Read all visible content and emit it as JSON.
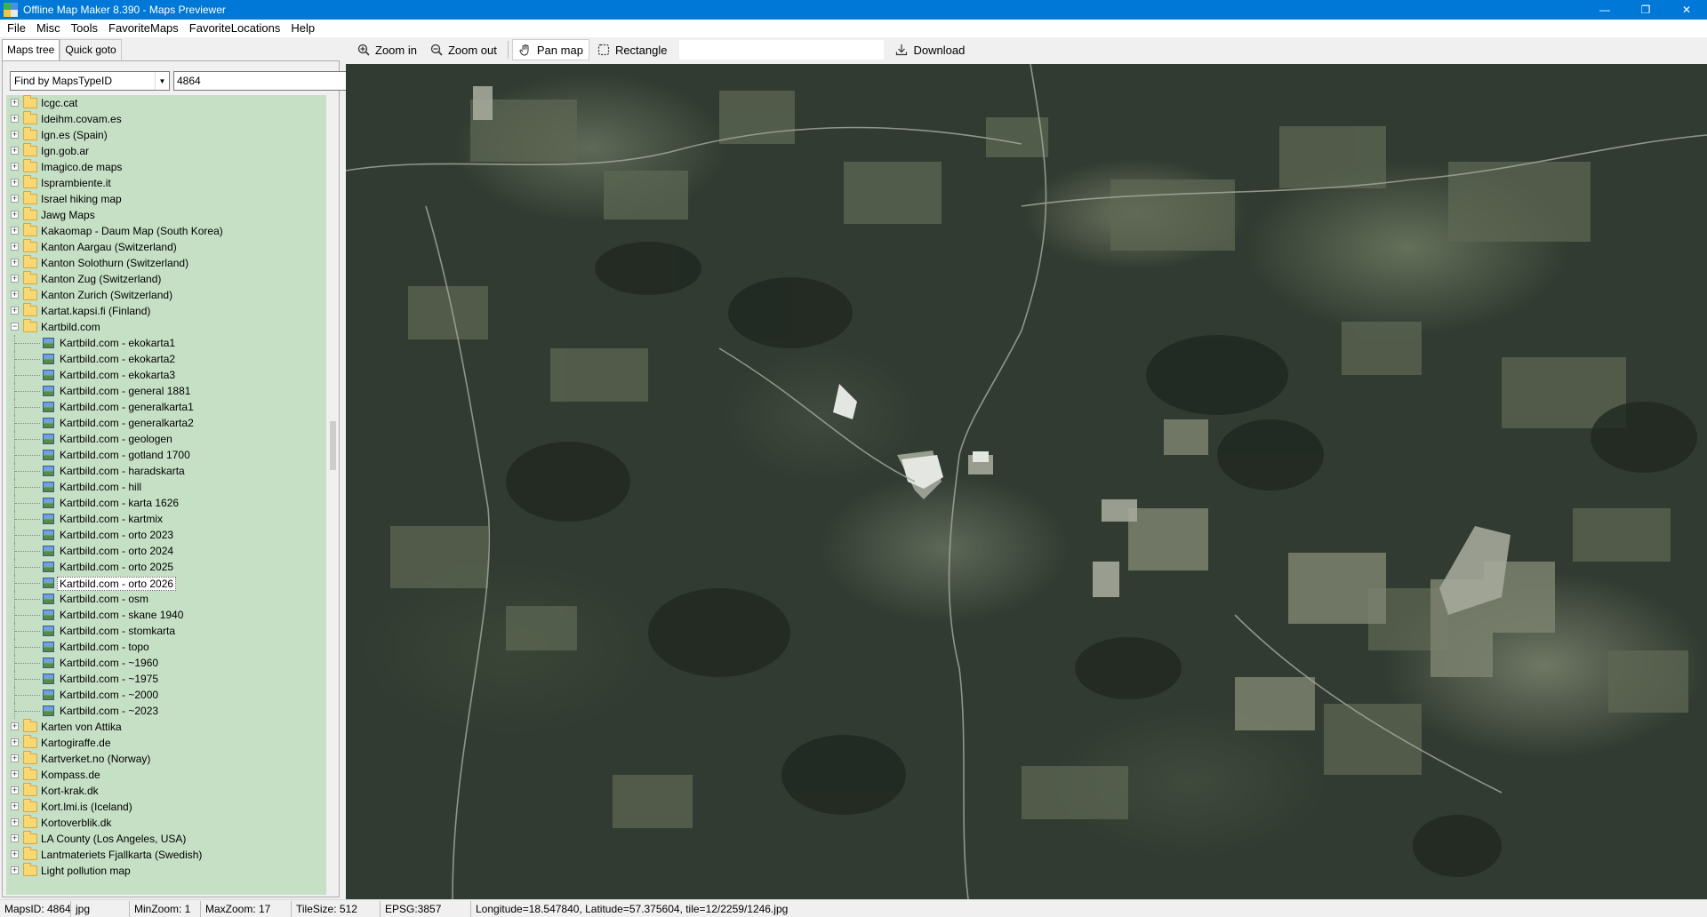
{
  "window": {
    "title": "Offline Map Maker 8.390 - Maps Previewer",
    "minimize": "—",
    "maximize": "❐",
    "close": "✕"
  },
  "menu": [
    "File",
    "Misc",
    "Tools",
    "FavoriteMaps",
    "FavoriteLocations",
    "Help"
  ],
  "left": {
    "tabs": [
      "Maps tree",
      "Quick goto"
    ],
    "find_mode": "Find by MapsTypeID",
    "find_value": "4864",
    "tree_top": [
      "Icgc.cat",
      "Ideihm.covam.es",
      "Ign.es (Spain)",
      "Ign.gob.ar",
      "Imagico.de maps",
      "Isprambiente.it",
      "Israel hiking map",
      "Jawg Maps",
      "Kakaomap - Daum Map (South Korea)",
      "Kanton Aargau (Switzerland)",
      "Kanton Solothurn (Switzerland)",
      "Kanton Zug (Switzerland)",
      "Kanton Zurich (Switzerland)",
      "Kartat.kapsi.fi (Finland)"
    ],
    "expanded_folder": "Kartbild.com",
    "tree_children": [
      "Kartbild.com - ekokarta1",
      "Kartbild.com - ekokarta2",
      "Kartbild.com - ekokarta3",
      "Kartbild.com - general 1881",
      "Kartbild.com - generalkarta1",
      "Kartbild.com - generalkarta2",
      "Kartbild.com - geologen",
      "Kartbild.com - gotland 1700",
      "Kartbild.com - haradskarta",
      "Kartbild.com - hill",
      "Kartbild.com - karta 1626",
      "Kartbild.com - kartmix",
      "Kartbild.com - orto 2023",
      "Kartbild.com - orto 2024",
      "Kartbild.com - orto 2025",
      "Kartbild.com - orto 2026",
      "Kartbild.com - osm",
      "Kartbild.com - skane 1940",
      "Kartbild.com - stomkarta",
      "Kartbild.com - topo",
      "Kartbild.com - ~1960",
      "Kartbild.com - ~1975",
      "Kartbild.com - ~2000",
      "Kartbild.com - ~2023"
    ],
    "selected_child": "Kartbild.com - orto 2026",
    "tree_bottom": [
      "Karten von Attika",
      "Kartogiraffe.de",
      "Kartverket.no (Norway)",
      "Kompass.de",
      "Kort-krak.dk",
      "Kort.lmi.is (Iceland)",
      "Kortoverblik.dk",
      "LA County (Los Angeles, USA)",
      "Lantmateriets Fjallkarta (Swedish)",
      "Light pollution map"
    ]
  },
  "toolbar": {
    "zoom_in": "Zoom in",
    "zoom_out": "Zoom out",
    "pan_map": "Pan map",
    "rectangle": "Rectangle",
    "download": "Download"
  },
  "status": {
    "maps_id": "MapsID: 4864",
    "format": "jpg",
    "min_zoom": "MinZoom: 1",
    "max_zoom": "MaxZoom: 17",
    "tile_size": "TileSize: 512",
    "epsg": "EPSG:3857",
    "coords": "Longitude=18.547840, Latitude=57.375604, tile=12/2259/1246.jpg"
  },
  "colors": {
    "titlebar": "#0078d7",
    "tree_bg": "#c6e0c6",
    "map_forest": "#323b31"
  }
}
